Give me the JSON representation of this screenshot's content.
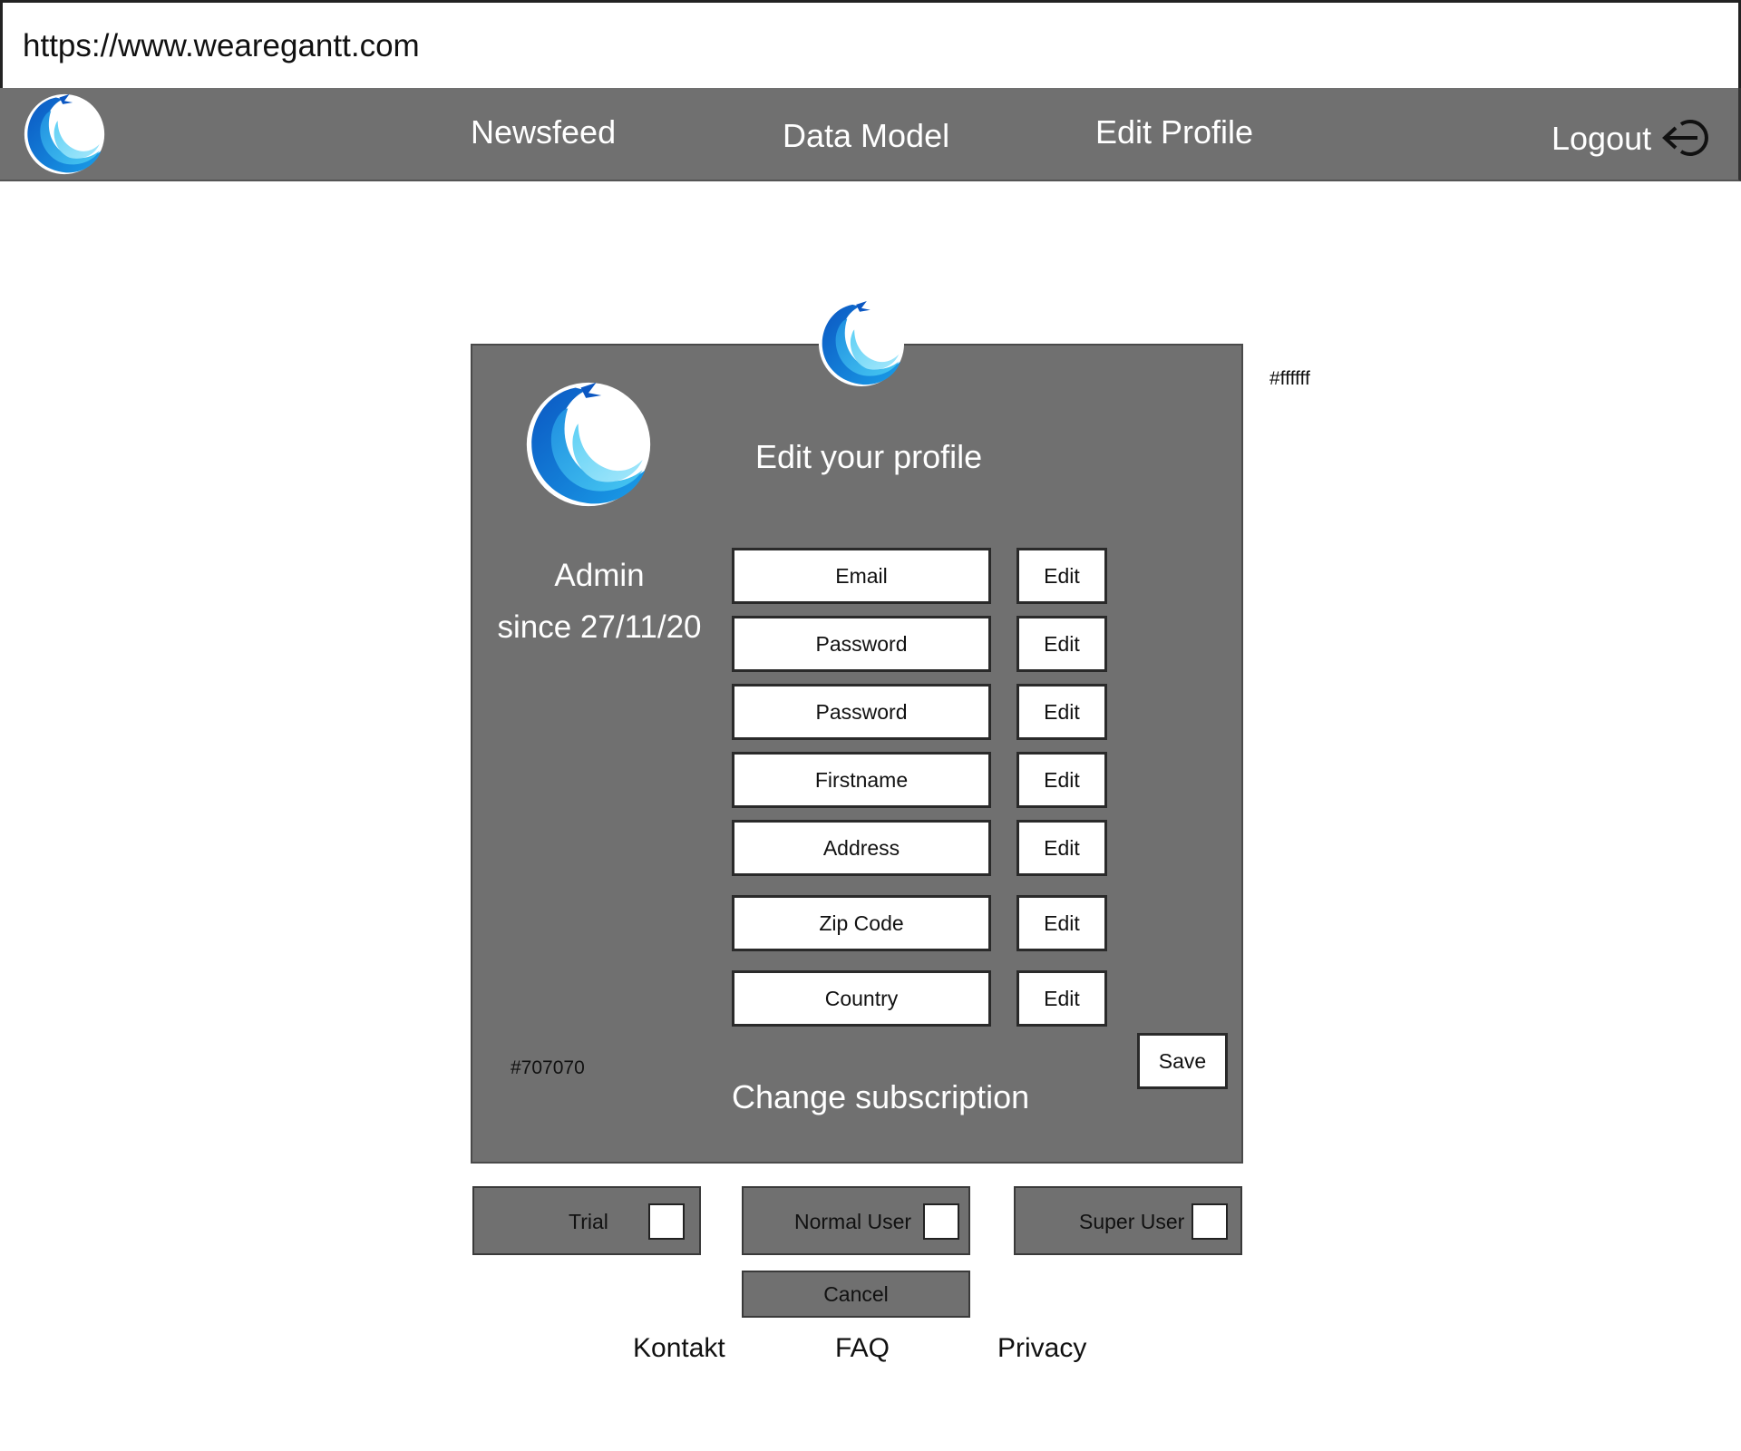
{
  "browser": {
    "url": "https://www.wearegantt.com"
  },
  "nav": {
    "items": [
      {
        "label": "Newsfeed"
      },
      {
        "label": "Data Model"
      },
      {
        "label": "Edit Profile"
      }
    ],
    "logout_label": "Logout"
  },
  "profile": {
    "title": "Edit your profile",
    "role": "Admin",
    "since": "since 27/11/20",
    "fields": [
      {
        "label": "Email",
        "edit": "Edit"
      },
      {
        "label": "Password",
        "edit": "Edit"
      },
      {
        "label": "Password",
        "edit": "Edit"
      },
      {
        "label": "Firstname",
        "edit": "Edit"
      },
      {
        "label": "Address",
        "edit": "Edit"
      },
      {
        "label": "Zip Code",
        "edit": "Edit"
      },
      {
        "label": "Country",
        "edit": "Edit"
      }
    ],
    "save_label": "Save",
    "panel_color_note": "#707070",
    "subscription_title": "Change subscription"
  },
  "background_color_note": "#ffffff",
  "subscription": {
    "options": [
      {
        "label": "Trial",
        "checked": false
      },
      {
        "label": "Normal User",
        "checked": false
      },
      {
        "label": "Super User",
        "checked": false
      }
    ],
    "cancel_label": "Cancel"
  },
  "footer": {
    "links": [
      "Kontakt",
      "FAQ",
      "Privacy"
    ]
  },
  "colors": {
    "panel": "#707070",
    "background": "#ffffff",
    "logo_dark_blue": "#0a5fc4",
    "logo_light_blue": "#3fc3f0"
  },
  "icons": {
    "logo": "eagle-wave-logo-icon",
    "logout": "logout-arrow-icon"
  }
}
